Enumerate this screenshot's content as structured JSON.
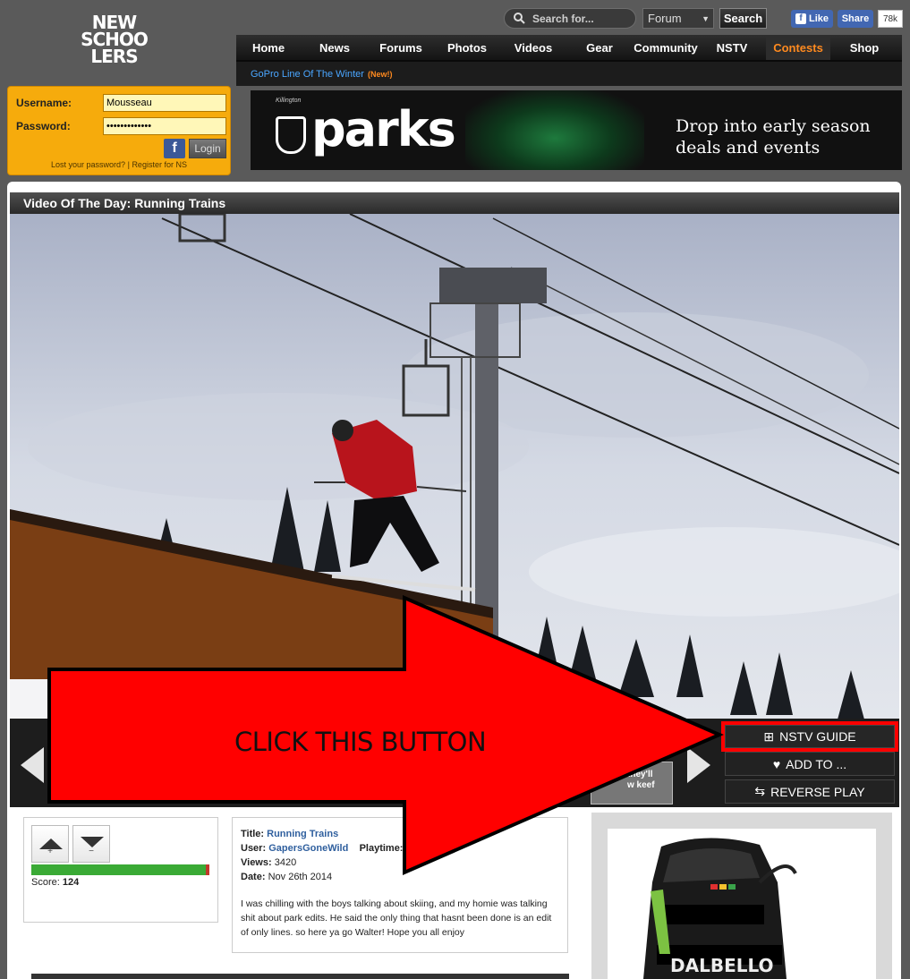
{
  "header": {
    "logo_lines": [
      "NEW",
      "SCHOO",
      "LERS"
    ],
    "search": {
      "placeholder": "Search for..."
    },
    "forum_select": "Forum",
    "search_button": "Search",
    "fb_like": "Like",
    "fb_share": "Share",
    "fb_count": "78k"
  },
  "nav": {
    "items": [
      "Home",
      "News",
      "Forums",
      "Photos",
      "Videos",
      "Gear",
      "Community",
      "NSTV",
      "Contests",
      "Shop"
    ],
    "active": "Contests"
  },
  "subnav": {
    "link": "GoPro Line Of The Winter",
    "badge": "(New!)"
  },
  "login": {
    "username_label": "Username:",
    "username_value": "Mousseau",
    "password_label": "Password:",
    "password_value": "•••••••••••••",
    "login_button": "Login",
    "facebook_icon": "f",
    "lost_password": "Lost your password?",
    "separator": "|",
    "register": "Register for NS"
  },
  "banner": {
    "small": "Killington",
    "brand": "parks",
    "tagline_1": "Drop into early season",
    "tagline_2": "deals and events"
  },
  "video": {
    "title": "Video Of The Day: Running Trains"
  },
  "controls": {
    "nstv_guide": "NSTV GUIDE",
    "add_to": "ADD TO ...",
    "reverse_play": "REVERSE PLAY",
    "thumb_caption_1": "they'll",
    "thumb_caption_2": "w keef",
    "icons": {
      "nstv_guide": "grid-icon",
      "add_to": "heart-icon",
      "reverse_play": "arrows-icon"
    }
  },
  "voting": {
    "up_symbol": "+",
    "down_symbol": "−",
    "score_label": "Score:",
    "score_value": "124",
    "score_fraction": 0.98
  },
  "details": {
    "title_label": "Title:",
    "title_value": "Running Trains",
    "user_label": "User:",
    "user_value": "GapersGoneWild",
    "playtime_label": "Playtime:",
    "views_label": "Views:",
    "views_value": "3420",
    "date_label": "Date:",
    "date_value": "Nov 26th 2014",
    "description": "I was chilling with the boys talking about skiing, and my homie was talking shit about park edits. He said the only thing that hasnt been done is an edit of only lines. so here ya go Walter! Hope you all enjoy"
  },
  "ad": {
    "boot_text": "DALBELLO"
  },
  "callout": {
    "text": "CLICK THIS BUTTON",
    "color": "#ff0000"
  }
}
